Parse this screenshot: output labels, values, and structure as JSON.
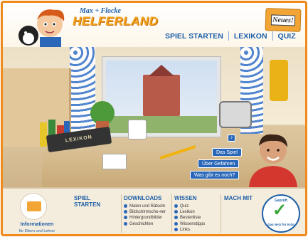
{
  "header": {
    "logo_top": "Max + Flocke",
    "logo_main": "HELFERLAND",
    "news_label": "Neues!"
  },
  "nav": {
    "items": [
      "SPIEL STARTEN",
      "LEXIKON",
      "QUIZ"
    ]
  },
  "scene": {
    "book_label": "LEXIKON",
    "buttons": [
      "Das Spiel",
      "Über Gefahren",
      "Was gibt es noch?"
    ]
  },
  "footer": {
    "info_label": "Informationen",
    "info_sub": "für Eltern und Lehrer",
    "spiel": {
      "title": "SPIEL STARTEN"
    },
    "downloads": {
      "title": "DOWNLOADS",
      "items": [
        "Malen und Rätseln",
        "Bildschirmscho-ner",
        "Hintergrundbilder",
        "Geschichten"
      ]
    },
    "wissen": {
      "title": "WISSEN",
      "items": [
        "Quiz",
        "Lexikon",
        "Bestenliste",
        "Wissenstipps",
        "Links"
      ]
    },
    "machmit": {
      "title": "MACH MIT"
    },
    "seal": {
      "top": "Geprüft",
      "bottom": "Das Netz für Kids"
    }
  },
  "colors": {
    "accent": "#f08a1c",
    "brand_blue": "#1d5fa8",
    "button_blue": "#2a67b8"
  }
}
